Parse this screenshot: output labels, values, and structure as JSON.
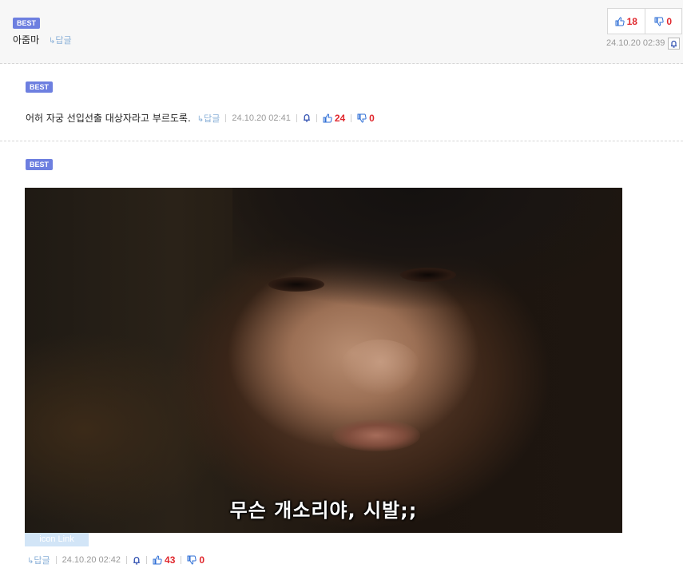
{
  "comments": [
    {
      "badge": "BEST",
      "text": "아줌마",
      "reply_label": "답글",
      "date": "24.10.20 02:39",
      "upvotes": "18",
      "downvotes": "0"
    },
    {
      "badge": "BEST",
      "text": "어허 자궁 선입선출 대상자라고 부르도록.",
      "reply_label": "답글",
      "date": "24.10.20 02:41",
      "upvotes": "24",
      "downvotes": "0"
    },
    {
      "badge": "BEST",
      "image_subtitle": "무슨 개소리야, 시발;;",
      "icon_link_label": "icon Link",
      "reply_label": "답글",
      "date": "24.10.20 02:42",
      "upvotes": "43",
      "downvotes": "0"
    }
  ],
  "icons": {
    "reply": "reply-arrow-icon",
    "report": "bell-report-icon",
    "like": "thumbs-up-icon",
    "dislike": "thumbs-down-icon"
  },
  "colors": {
    "badge": "#6d7fe0",
    "vote_count": "#e0282e",
    "thumb_icon": "#2f6fd6",
    "reply_link": "#8ab0d8"
  }
}
